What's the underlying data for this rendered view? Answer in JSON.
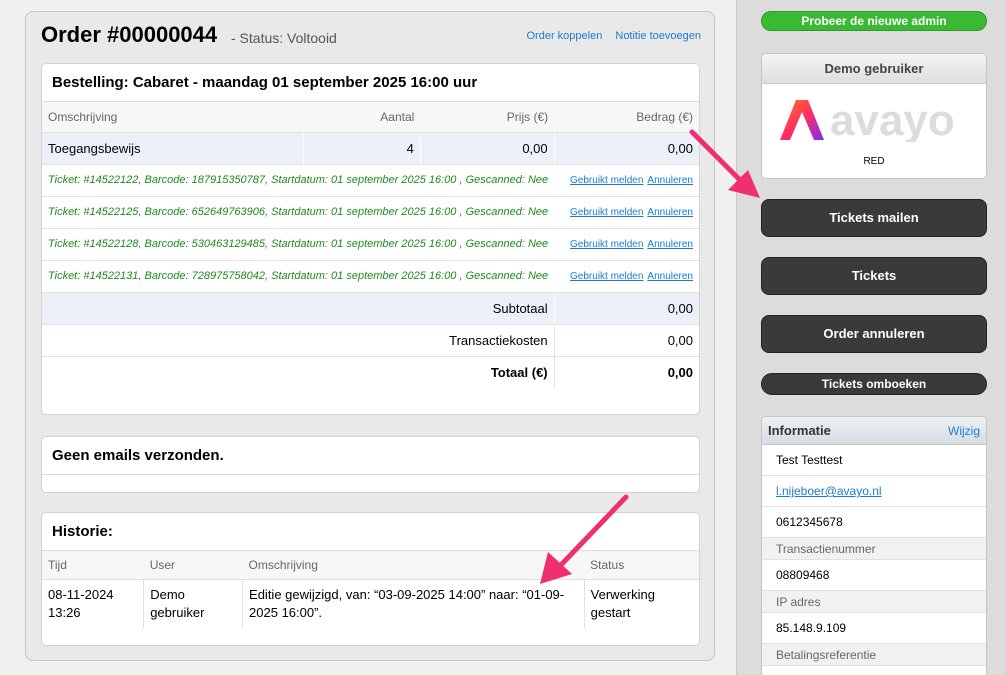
{
  "order": {
    "title": "Order #00000044",
    "status": "- Status: Voltooid",
    "links": [
      "Order koppelen",
      "Notitie toevoegen"
    ]
  },
  "bestelling": {
    "title": "Bestelling: Cabaret - maandag 01 september 2025 16:00 uur",
    "columns": [
      "Omschrijving",
      "Aantal",
      "Prijs (€)",
      "Bedrag (€)"
    ],
    "item": {
      "name": "Toegangsbewijs",
      "aantal": "4",
      "prijs": "0,00",
      "bedrag": "0,00"
    },
    "tickets": [
      "Ticket: #14522122, Barcode: 187915350787, Startdatum: 01 september 2025 16:00 , Gescanned: Nee",
      "Ticket: #14522125, Barcode: 652649763906, Startdatum: 01 september 2025 16:00 , Gescanned: Nee",
      "Ticket: #14522128, Barcode: 530463129485, Startdatum: 01 september 2025 16:00 , Gescanned: Nee",
      "Ticket: #14522131, Barcode: 728975758042, Startdatum: 01 september 2025 16:00 , Gescanned: Nee"
    ],
    "ticket_action_used": "Gebruikt melden",
    "ticket_action_cancel": "Annuleren",
    "subtotaal_label": "Subtotaal",
    "subtotaal": "0,00",
    "transactie_label": "Transactiekosten",
    "transactie": "0,00",
    "totaal_label": "Totaal (€)",
    "totaal": "0,00"
  },
  "emails": {
    "title": "Geen emails verzonden."
  },
  "historie": {
    "title": "Historie:",
    "columns": [
      "Tijd",
      "User",
      "Omschrijving",
      "Status"
    ],
    "row": {
      "tijd": "08-11-2024 13:26",
      "user": "Demo gebruiker",
      "omschrijving": "Editie gewijzigd, van: “03-09-2025 14:00” naar: “01-09-2025 16:00”.",
      "status": "Verwerking gestart"
    }
  },
  "sidebar": {
    "new_admin": "Probeer de nieuwe admin",
    "demo_title": "Demo gebruiker",
    "logo_text": "avayo",
    "demo_sub": "RED",
    "buttons": [
      "Tickets mailen",
      "Tickets",
      "Order annuleren",
      "Tickets omboeken"
    ],
    "info": {
      "title": "Informatie",
      "edit": "Wijzig",
      "name": "Test Testtest",
      "email": "l.nijeboer@avayo.nl",
      "phone": "0612345678",
      "transactie_label": "Transactienummer",
      "transactie": "08809468",
      "ip_label": "IP adres",
      "ip": "85.148.9.109",
      "betaling_label": "Betalingsreferentie"
    }
  },
  "colors": {
    "accent": "#1a7bd0",
    "green": "#3aba33",
    "ticket_green": "#1e8a1e",
    "arrow": "#ef2f6e"
  }
}
